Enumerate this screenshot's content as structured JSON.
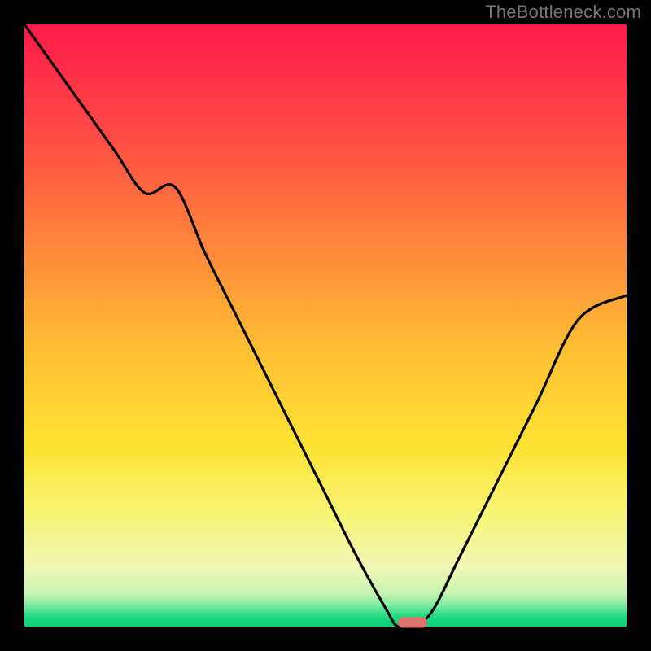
{
  "watermark": "TheBottleneck.com",
  "colors": {
    "background": "#000000",
    "watermark_text": "#777777",
    "curve": "#000000",
    "marker": "#e0716b",
    "gradient_stops": [
      {
        "offset": 0.0,
        "color": "#ff1a4b"
      },
      {
        "offset": 0.18,
        "color": "#ff4a45"
      },
      {
        "offset": 0.38,
        "color": "#ff8a3a"
      },
      {
        "offset": 0.55,
        "color": "#ffc234"
      },
      {
        "offset": 0.7,
        "color": "#ffe234"
      },
      {
        "offset": 0.82,
        "color": "#f7f67a"
      },
      {
        "offset": 0.9,
        "color": "#f2f7b5"
      },
      {
        "offset": 0.945,
        "color": "#c7f3b2"
      },
      {
        "offset": 0.965,
        "color": "#7beaa0"
      },
      {
        "offset": 0.985,
        "color": "#18d87f"
      },
      {
        "offset": 1.0,
        "color": "#0fce77"
      }
    ]
  },
  "chart_data": {
    "type": "line",
    "title": "",
    "xlabel": "",
    "ylabel": "",
    "xlim": [
      0,
      100
    ],
    "ylim": [
      0,
      100
    ],
    "x": [
      0,
      5,
      10,
      15,
      20,
      25,
      30,
      35,
      40,
      45,
      50,
      55,
      60,
      62,
      65,
      68,
      72,
      78,
      85,
      92,
      100
    ],
    "values": [
      100,
      93,
      86,
      79,
      72,
      73,
      62,
      52,
      42,
      32,
      22,
      12,
      3,
      0,
      0,
      3,
      11,
      23,
      37,
      51,
      55
    ],
    "minimum_x": 64,
    "minimum_y": 0,
    "marker": {
      "x": 64.5,
      "y": 0.7
    },
    "legend": [],
    "grid": false
  }
}
